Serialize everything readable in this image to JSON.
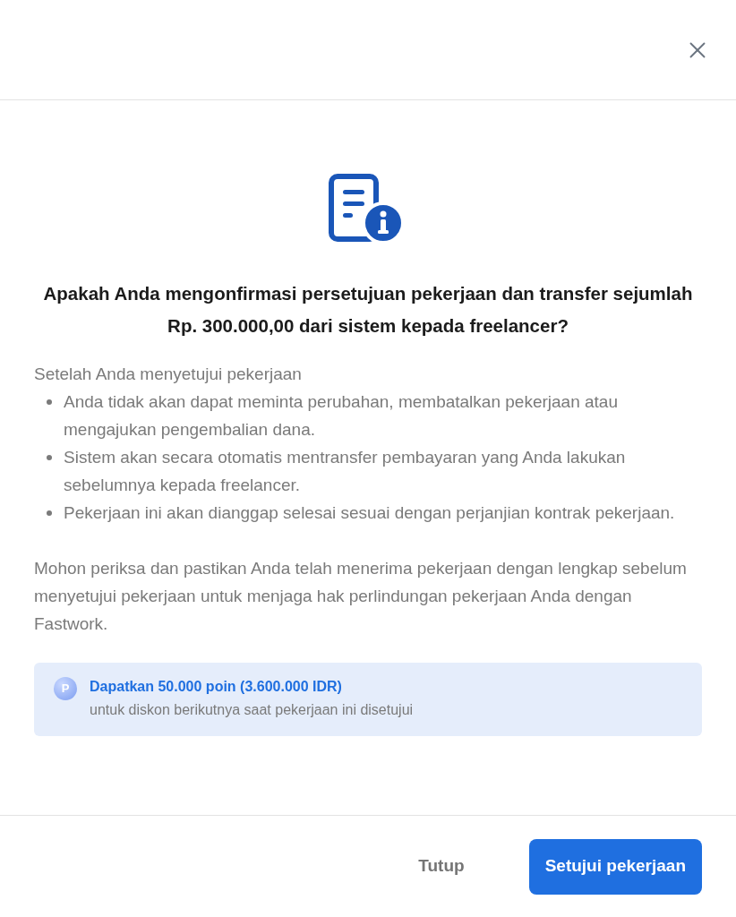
{
  "title": "Apakah Anda mengonfirmasi persetujuan pekerjaan dan transfer sejumlah Rp. 300.000,00 dari sistem kepada freelancer?",
  "intro": "Setelah Anda menyetujui pekerjaan",
  "bullets": [
    "Anda tidak akan dapat meminta perubahan, membatalkan pekerjaan atau mengajukan pengembalian dana.",
    "Sistem akan secara otomatis mentransfer pembayaran yang Anda lakukan sebelumnya kepada freelancer.",
    "Pekerjaan ini akan dianggap selesai sesuai dengan perjanjian kontrak pekerjaan."
  ],
  "note": "Mohon periksa dan pastikan Anda telah menerima pekerjaan dengan lengkap sebelum menyetujui pekerjaan untuk menjaga hak perlindungan pekerjaan Anda dengan Fastwork.",
  "points": {
    "badge": "P",
    "headline": "Dapatkan 50.000 poin (3.600.000 IDR)",
    "detail": "untuk diskon berikutnya saat pekerjaan ini disetujui"
  },
  "buttons": [
    {
      "label": "Tutup",
      "kind": "secondary"
    },
    {
      "label": "Setujui pekerjaan",
      "kind": "primary"
    }
  ]
}
